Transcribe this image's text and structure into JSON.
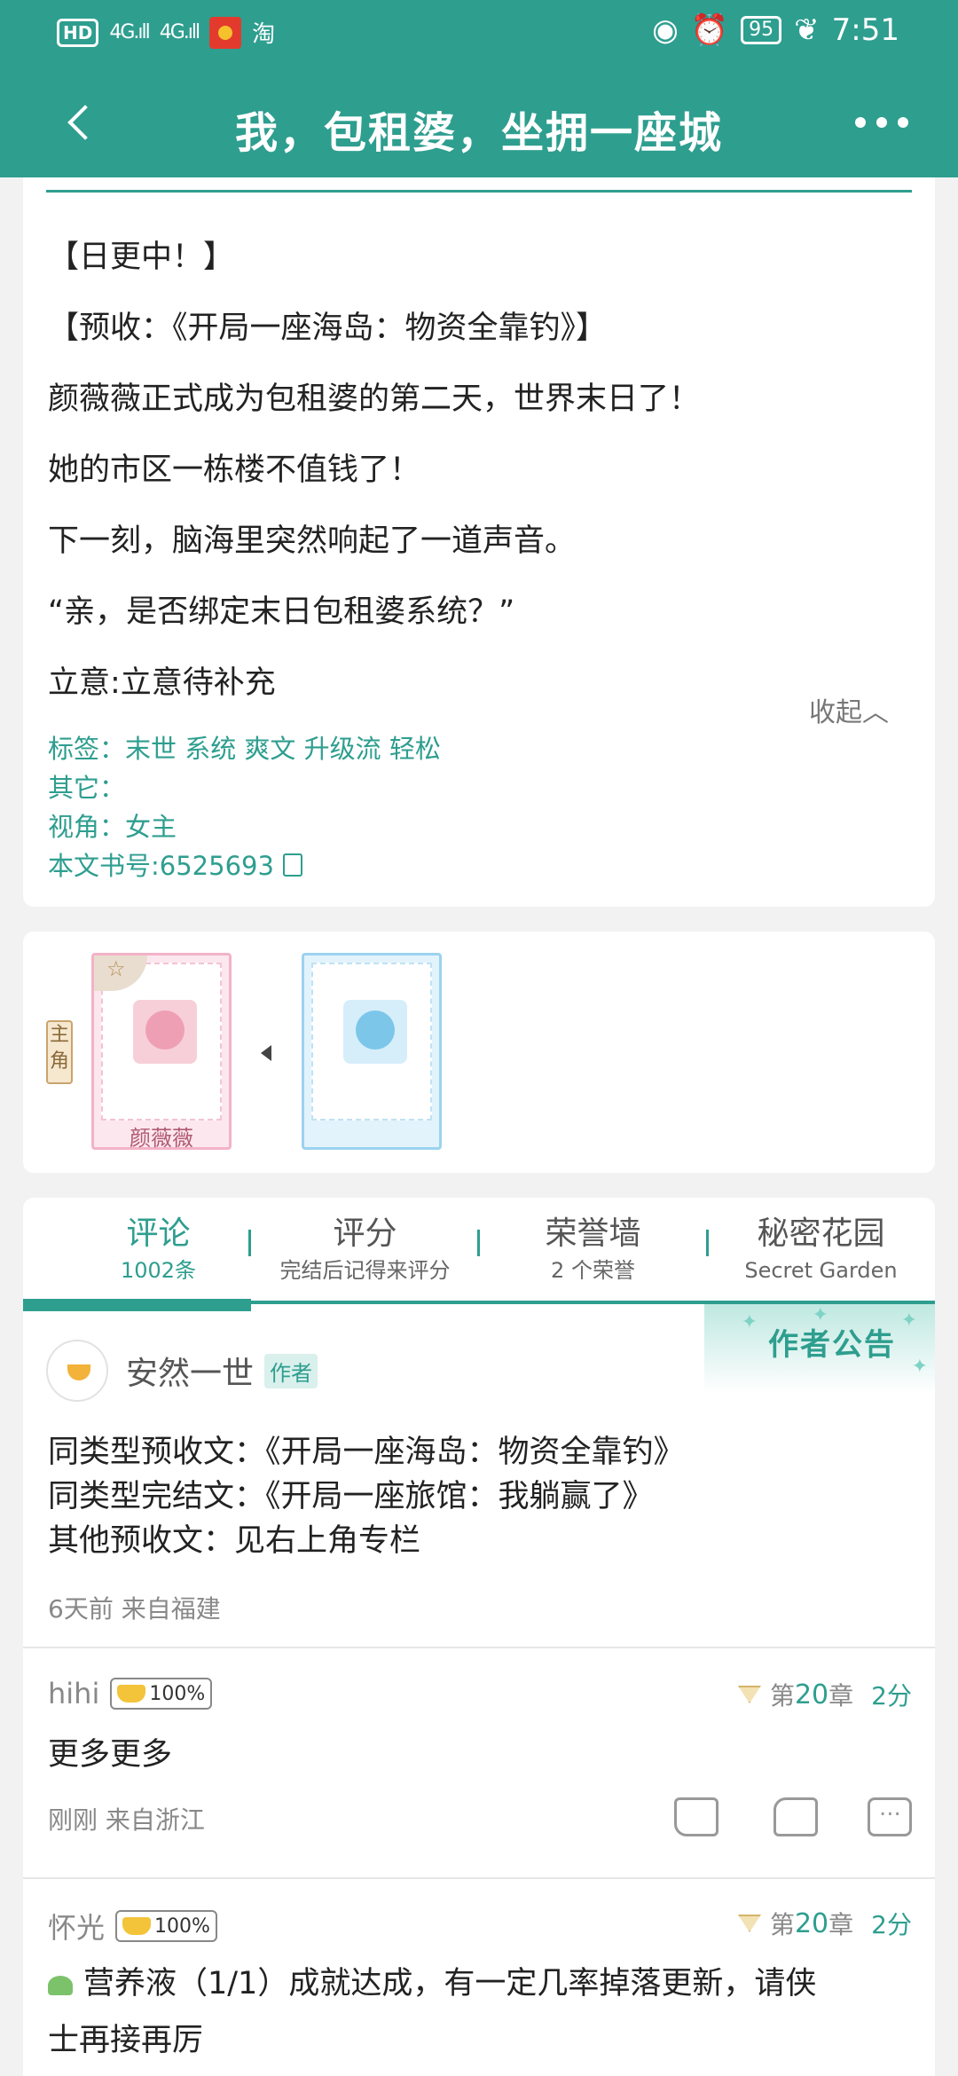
{
  "status_bar": {
    "left_hd": "HD",
    "left_sig1": "4G.ıll",
    "left_sig2": "4G.ıll",
    "left_taobao": "淘",
    "battery": "95",
    "time": "7:51"
  },
  "titlebar": {
    "title": "我，包租婆，坐拥一座城"
  },
  "synopsis": {
    "lines": [
      "【日更中！】",
      "【预收：《开局一座海岛：物资全靠钓》】",
      "颜薇薇正式成为包租婆的第二天，世界末日了！",
      "她的市区一栋楼不值钱了！",
      "下一刻，脑海里突然响起了一道声音。",
      "“亲，是否绑定末日包租婆系统？”",
      "立意:立意待补充"
    ],
    "collapse_label": "收起︿",
    "tags": "标签：末世 系统 爽文 升级流 轻松",
    "other": "其它：",
    "pov": "视角：女主",
    "book_id": "本文书号:6525693"
  },
  "characters": {
    "role_tag": "主角",
    "char1_name": "颜薇薇",
    "corner_star": "☆"
  },
  "tabs": [
    {
      "title": "评论",
      "sub": "1002条"
    },
    {
      "title": "评分",
      "sub": "完结后记得来评分"
    },
    {
      "title": "荣誉墙",
      "sub": "2 个荣誉"
    },
    {
      "title": "秘密花园",
      "sub": "Secret Garden"
    }
  ],
  "notice": {
    "title": "作者公告",
    "author": "安然一世",
    "author_badge": "作者",
    "lines": [
      "同类型预收文：《开局一座海岛：物资全靠钓》",
      "同类型完结文：《开局一座旅馆：我躺赢了》",
      "其他预收文：见右上角专栏"
    ],
    "meta": "6天前 来自福建"
  },
  "comments": [
    {
      "user": "hihi",
      "badge": "100%",
      "chapter_prefix": "第",
      "chapter_num": "20",
      "chapter_suffix": "章",
      "score": "2分",
      "text": "更多更多",
      "meta": "刚刚  来自浙江"
    },
    {
      "user": "怀光",
      "badge": "100%",
      "chapter_prefix": "第",
      "chapter_num": "20",
      "chapter_suffix": "章",
      "score": "2分",
      "text1": "营养液（1/1）成就达成，有一定几率掉落更新，请侠",
      "text2": "士再接再厉"
    }
  ]
}
